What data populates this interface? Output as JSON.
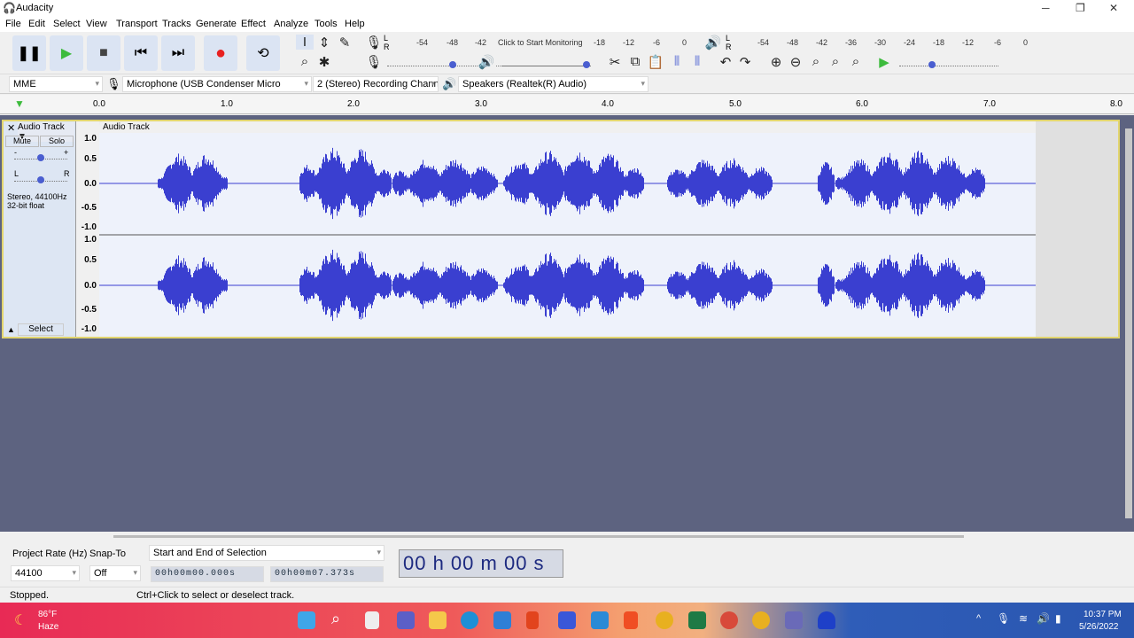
{
  "window": {
    "title": "Audacity"
  },
  "menu": [
    "File",
    "Edit",
    "Select",
    "View",
    "Transport",
    "Tracks",
    "Generate",
    "Effect",
    "Analyze",
    "Tools",
    "Help"
  ],
  "transport": {
    "pause": "pause-icon",
    "play": "play-icon",
    "stop": "stop-icon",
    "skip_start": "skip-start-icon",
    "skip_end": "skip-end-icon",
    "record": "record-icon",
    "loop": "loop-icon"
  },
  "record_meter": {
    "lr": "L\nR",
    "ticks": [
      "-54",
      "-48",
      "-42",
      "-18",
      "-12",
      "-6",
      "0"
    ],
    "prompt": "Click to Start Monitoring"
  },
  "play_meter": {
    "ticks": [
      "-54",
      "-48",
      "-42",
      "-36",
      "-30",
      "-24",
      "-18",
      "-12",
      "-6",
      "0"
    ]
  },
  "device": {
    "host": "MME",
    "mic": "Microphone (USB Condenser Micro",
    "channels": "2 (Stereo) Recording Chann",
    "speaker": "Speakers (Realtek(R) Audio)"
  },
  "ruler": [
    "0.0",
    "1.0",
    "2.0",
    "3.0",
    "4.0",
    "5.0",
    "6.0",
    "7.0",
    "8.0"
  ],
  "track": {
    "name": "Audio Track",
    "mute": "Mute",
    "solo": "Solo",
    "gain_minus": "-",
    "gain_plus": "+",
    "pan_l": "L",
    "pan_r": "R",
    "info1": "Stereo, 44100Hz",
    "info2": "32-bit float",
    "select": "Select",
    "scale": [
      "1.0",
      "0.5",
      "0.0",
      "-0.5",
      "-1.0"
    ],
    "gain": 0.5,
    "pan": 0.5
  },
  "selection": {
    "rate_label": "Project Rate (Hz)",
    "rate": "44100",
    "snap_label": "Snap-To",
    "snap": "Off",
    "mode": "Start and End of Selection",
    "start": "00h00m00.000s",
    "end": "00h00m07.373s",
    "position": "00 h 00 m 00 s"
  },
  "status": {
    "state": "Stopped.",
    "hint": "Ctrl+Click to select or deselect track."
  },
  "taskbar": {
    "temp": "86°F",
    "weather": "Haze",
    "time": "10:37 PM",
    "date": "5/26/2022"
  },
  "colors": {
    "wave": "#3a3fd0",
    "track_bg": "#eef2fb",
    "bg": "#5d6380"
  }
}
